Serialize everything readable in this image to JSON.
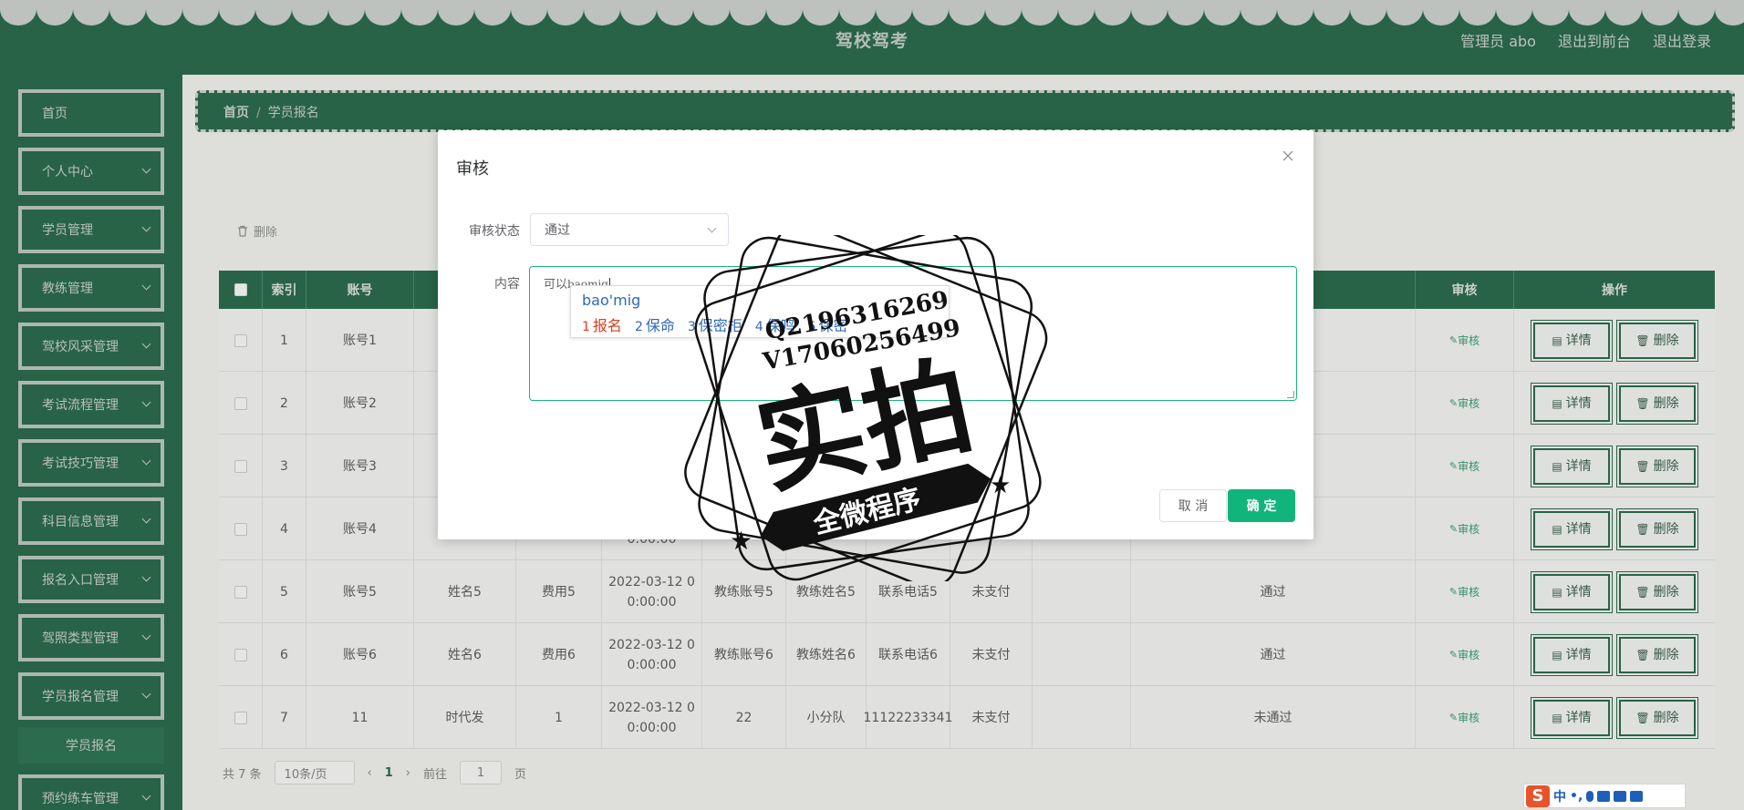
{
  "header": {
    "title": "驾校驾考",
    "admin_label": "管理员 abo",
    "front_link": "退出到前台",
    "logout_link": "退出登录"
  },
  "sidebar": {
    "items": [
      {
        "label": "首页"
      },
      {
        "label": "个人中心"
      },
      {
        "label": "学员管理"
      },
      {
        "label": "教练管理"
      },
      {
        "label": "驾校风采管理"
      },
      {
        "label": "考试流程管理"
      },
      {
        "label": "考试技巧管理"
      },
      {
        "label": "科目信息管理"
      },
      {
        "label": "报名入口管理"
      },
      {
        "label": "驾照类型管理"
      },
      {
        "label": "学员报名管理"
      },
      {
        "label": "预约练车管理"
      }
    ],
    "sub_item": "学员报名"
  },
  "breadcrumb": {
    "home": "首页",
    "sep": "/",
    "current": "学员报名"
  },
  "toolbar": {
    "delete_label": "删除"
  },
  "table": {
    "headers": {
      "index": "索引",
      "account": "账号",
      "audit": "审核",
      "ops": "操作"
    },
    "rows": [
      {
        "index": "1",
        "account": "账号1",
        "name": "",
        "fee": "",
        "date1": "",
        "date2": "",
        "coach_acct": "",
        "coach_name": "",
        "phone": "",
        "pay": "",
        "status": ""
      },
      {
        "index": "2",
        "account": "账号2",
        "name": "",
        "fee": "",
        "date1": "",
        "date2": "",
        "coach_acct": "",
        "coach_name": "",
        "phone": "",
        "pay": "",
        "status": ""
      },
      {
        "index": "3",
        "account": "账号3",
        "name": "",
        "fee": "",
        "date1": "",
        "date2": "",
        "coach_acct": "",
        "coach_name": "",
        "phone": "",
        "pay": "",
        "status": ""
      },
      {
        "index": "4",
        "account": "账号4",
        "name": "",
        "fee": "",
        "date1": "",
        "date2": "0:00:00",
        "coach_acct": "",
        "coach_name": "",
        "phone": "",
        "pay": "",
        "status": ""
      },
      {
        "index": "5",
        "account": "账号5",
        "name": "姓名5",
        "fee": "费用5",
        "date1": "2022-03-12 0",
        "date2": "0:00:00",
        "coach_acct": "教练账号5",
        "coach_name": "教练姓名5",
        "phone": "联系电话5",
        "pay": "未支付",
        "status": "通过"
      },
      {
        "index": "6",
        "account": "账号6",
        "name": "姓名6",
        "fee": "费用6",
        "date1": "2022-03-12 0",
        "date2": "0:00:00",
        "coach_acct": "教练账号6",
        "coach_name": "教练姓名6",
        "phone": "联系电话6",
        "pay": "未支付",
        "status": "通过"
      },
      {
        "index": "7",
        "account": "11",
        "name": "时代发",
        "fee": "1",
        "date1": "2022-03-12 0",
        "date2": "0:00:00",
        "coach_acct": "22",
        "coach_name": "小分队",
        "phone": "11122233341",
        "pay": "未支付",
        "status": "未通过"
      }
    ],
    "audit_link": "审核",
    "detail_btn": "详情",
    "delete_btn": "删除"
  },
  "pager": {
    "total": "共 7 条",
    "page_size": "10条/页",
    "prev": "‹",
    "current_page": "1",
    "next": "›",
    "goto_label": "前往",
    "goto_value": "1",
    "page_suffix": "页"
  },
  "dialog": {
    "title": "审核",
    "status_label": "审核状态",
    "status_value": "通过",
    "content_label": "内容",
    "content_text": "可以",
    "content_typed": "baomig",
    "ime_input": "bao'mig",
    "ime_candidates": [
      {
        "num": "1",
        "text": "报名"
      },
      {
        "num": "2",
        "text": "保命"
      },
      {
        "num": "3",
        "text": "保密柜"
      },
      {
        "num": "4",
        "text": "保鸣"
      },
      {
        "num": "5",
        "text": "保密"
      }
    ],
    "cancel_label": "取 消",
    "ok_label": "确 定"
  },
  "watermark": {
    "line1": "Q2196316269",
    "line2": "V17060256499",
    "big": "实拍",
    "ribbon": "全微程序"
  },
  "ime_bar": {
    "lang": "中",
    "punct": "•,"
  }
}
